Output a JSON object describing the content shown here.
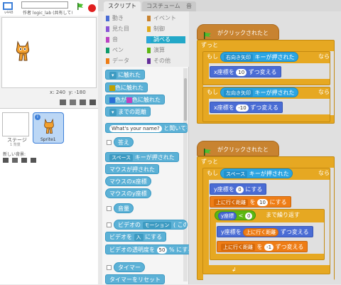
{
  "stage": {
    "version": "v448",
    "author": "作者 logic_lab (共有していない)",
    "coords_x": "x: 240",
    "coords_y": "y: -180"
  },
  "sprites": {
    "stage_label": "ステージ",
    "stage_sub": "1 背景",
    "new_bg": "新しい背景:",
    "sprite_name": "Sprite1"
  },
  "tabs": [
    "スクリプト",
    "コスチューム",
    "音"
  ],
  "categories": [
    {
      "label": "動き",
      "color": "#4a6cd4"
    },
    {
      "label": "イベント",
      "color": "#c88330"
    },
    {
      "label": "見た目",
      "color": "#8a55d7"
    },
    {
      "label": "制御",
      "color": "#e1a91a"
    },
    {
      "label": "音",
      "color": "#bb42c3"
    },
    {
      "label": "調べる",
      "color": "#2ca5e2"
    },
    {
      "label": "ペン",
      "color": "#0e9a6c"
    },
    {
      "label": "演算",
      "color": "#5cb712"
    },
    {
      "label": "データ",
      "color": "#ee7d16"
    },
    {
      "label": "その他",
      "color": "#632d99"
    }
  ],
  "palette": {
    "touching": "に触れた",
    "touching_color": "色に触れた",
    "color_touching": "色が",
    "color_touching2": "色に触れた",
    "distance": "までの距離",
    "ask_text": "What's your name?",
    "ask_suffix": "と聞いて待つ",
    "answer": "答え",
    "key_space": "スペース",
    "key_pressed": "キーが押された",
    "mouse_pressed": "マウスが押された",
    "mouse_x": "マウスのx座標",
    "mouse_y": "マウスのy座標",
    "loudness": "音量",
    "video_motion": "ビデオの",
    "video_motion2": "モーション",
    "video_motion3": "( この",
    "video_on": "ビデオを",
    "video_on_val": "入",
    "video_on_suffix": "にする",
    "video_trans": "ビデオの透明度を",
    "video_trans_val": "50",
    "video_trans_suffix": "% にする",
    "timer": "タイマー",
    "timer_reset": "タイマーをリセット"
  },
  "script1": {
    "hat": "がクリックされたとき",
    "forever": "ずっと",
    "if1_label": "もし",
    "if1_key": "右向き矢印",
    "if1_pressed": "キーが押された",
    "if1_then": "なら",
    "change_x1": "x座標を",
    "change_x1_val": "10",
    "change_x1_suffix": "ずつ変える",
    "if2_label": "もし",
    "if2_key": "左向き矢印",
    "if2_pressed": "キーが押された",
    "if2_then": "なら",
    "change_x2": "x座標を",
    "change_x2_val": "-10",
    "change_x2_suffix": "ずつ変える"
  },
  "script2": {
    "hat": "がクリックされたとき",
    "forever": "ずっと",
    "if_label": "もし",
    "if_key": "スペース",
    "if_pressed": "キーが押された",
    "if_then": "なら",
    "set_y": "y座標を",
    "set_y_val": "0",
    "set_y_suffix": "にする",
    "set_var": "上に行く距離",
    "set_var_prefix": "を",
    "set_var_val": "10",
    "set_var_suffix": "にする",
    "until_var": "y座標",
    "until_lt": "<",
    "until_val": "0",
    "until_suffix": "まで繰り返す",
    "change_y": "y座標を",
    "change_y_var": "上に行く距離",
    "change_y_suffix": "ずつ変える",
    "change_var": "上に行く距離",
    "change_var_prefix": "を",
    "change_var_val": "-1",
    "change_var_suffix": "ずつ変える"
  }
}
